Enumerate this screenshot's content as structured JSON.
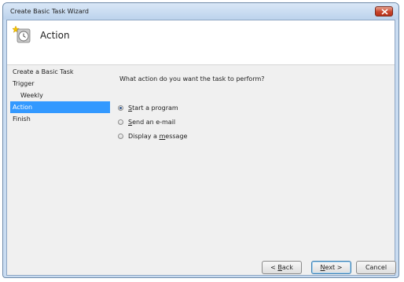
{
  "window": {
    "title": "Create Basic Task Wizard"
  },
  "header": {
    "title": "Action",
    "icon": "task-scheduler-clock-icon"
  },
  "nav": {
    "items": [
      {
        "label": "Create a Basic Task",
        "active": false
      },
      {
        "label": "Trigger",
        "active": false
      },
      {
        "label": "Weekly",
        "active": false
      },
      {
        "label": "Action",
        "active": true
      },
      {
        "label": "Finish",
        "active": false
      }
    ]
  },
  "main": {
    "question": "What action do you want the task to perform?",
    "options": [
      {
        "pre": "",
        "key": "S",
        "post": "tart a program",
        "selected": true
      },
      {
        "pre": "",
        "key": "S",
        "post": "end an e-mail",
        "selected": false
      },
      {
        "pre": "Display a ",
        "key": "m",
        "post": "essage",
        "selected": false
      }
    ]
  },
  "buttons": {
    "back_pre": "< ",
    "back_key": "B",
    "back_post": "ack",
    "next_key": "N",
    "next_post": "ext >",
    "cancel": "Cancel"
  },
  "colors": {
    "selection": "#3399ff",
    "frame": "#c9dcf1",
    "close": "#c7442b"
  }
}
